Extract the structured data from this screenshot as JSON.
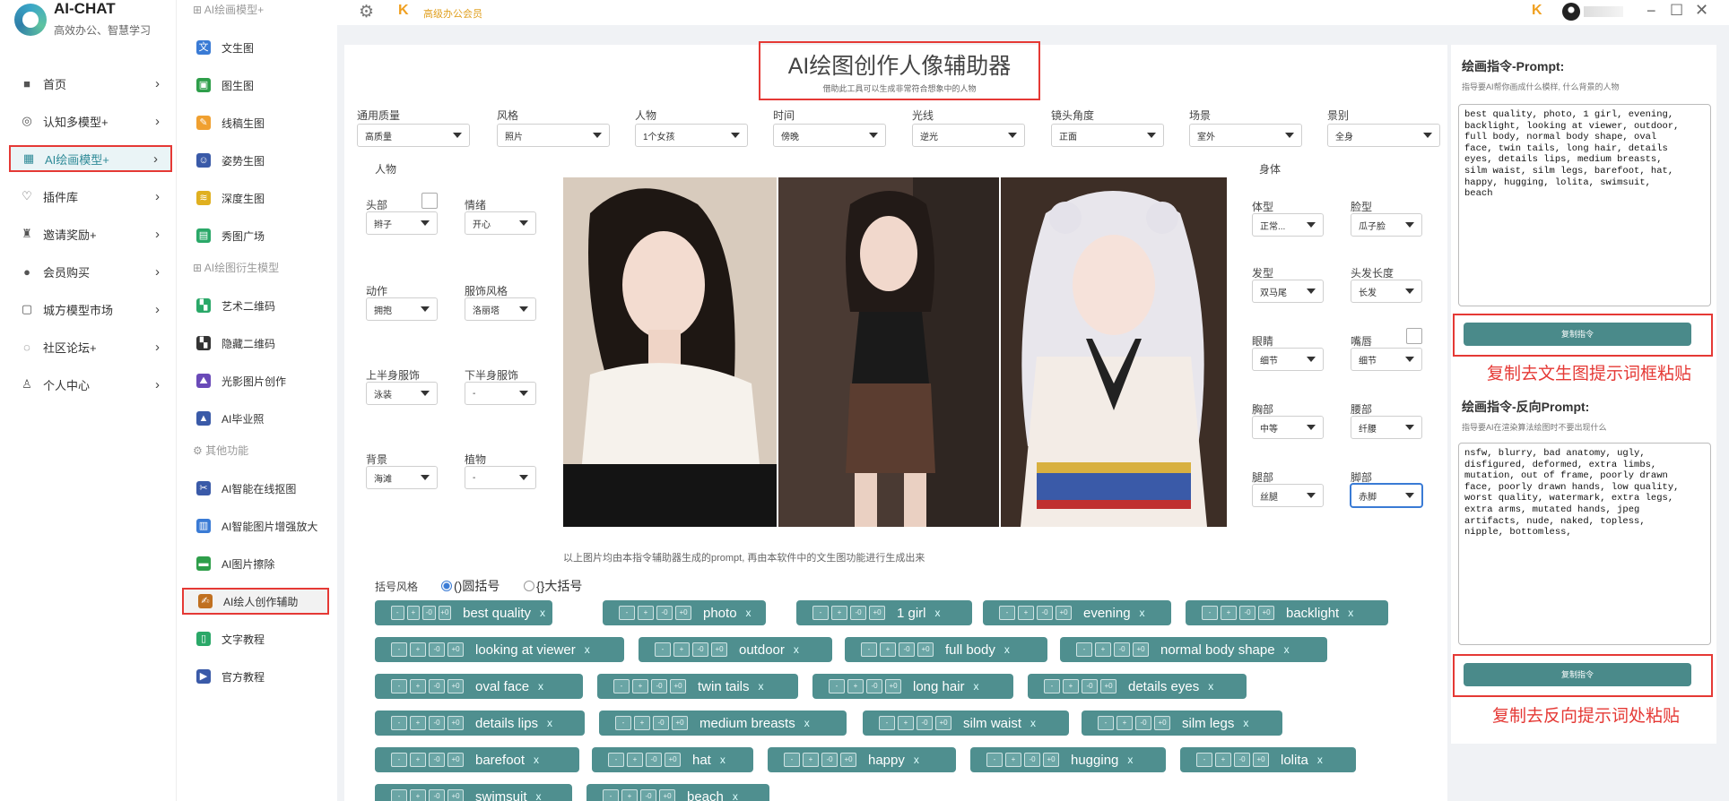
{
  "app": {
    "name": "AI-CHAT",
    "tagline": "高效办公、智慧学习"
  },
  "sidebar": {
    "items": [
      {
        "label": "首页",
        "icon": "home-icon"
      },
      {
        "label": "认知多模型+",
        "icon": "brain-icon"
      },
      {
        "label": "AI绘画模型+",
        "icon": "paint-icon"
      },
      {
        "label": "插件库",
        "icon": "plugin-icon"
      },
      {
        "label": "邀请奖励+",
        "icon": "gift-icon"
      },
      {
        "label": "会员购买",
        "icon": "user-icon"
      },
      {
        "label": "城方模型市场",
        "icon": "store-icon"
      },
      {
        "label": "社区论坛+",
        "icon": "chat-icon"
      },
      {
        "label": "个人中心",
        "icon": "person-icon"
      }
    ]
  },
  "submenu": {
    "header_top": "AI绘画模型+",
    "group1": [
      {
        "label": "文生图",
        "color": "#3a7bd5"
      },
      {
        "label": "图生图",
        "color": "#2e9e4a"
      },
      {
        "label": "线稿生图",
        "color": "#f0a030"
      },
      {
        "label": "姿势生图",
        "color": "#3a5aa8"
      },
      {
        "label": "深度生图",
        "color": "#e0b020"
      },
      {
        "label": "秀图广场",
        "color": "#2aa868"
      }
    ],
    "header_derive": "AI绘图衍生模型",
    "group2": [
      {
        "label": "艺术二维码",
        "color": "#2aa868"
      },
      {
        "label": "隐藏二维码",
        "color": "#333333"
      },
      {
        "label": "光影图片创作",
        "color": "#6a4ab8"
      },
      {
        "label": "AI毕业照",
        "color": "#3a5aa8"
      }
    ],
    "header_other": "其他功能",
    "group3": [
      {
        "label": "AI智能在线抠图",
        "color": "#3a5aa8"
      },
      {
        "label": "AI智能图片增强放大",
        "color": "#3a7bd5"
      },
      {
        "label": "AI图片擦除",
        "color": "#2e9e4a"
      },
      {
        "label": "AI绘人创作辅助",
        "color": "#c07020"
      },
      {
        "label": "文字教程",
        "color": "#2aa868"
      },
      {
        "label": "官方教程",
        "color": "#3a5aa8"
      }
    ]
  },
  "topbar": {
    "member_label": "高级办公会员"
  },
  "main": {
    "title": "AI绘图创作人像辅助器",
    "subtitle": "借助此工具可以生成非常符合想象中的人物",
    "filters": [
      {
        "label": "通用质量",
        "value": "高质量"
      },
      {
        "label": "风格",
        "value": "照片"
      },
      {
        "label": "人物",
        "value": "1个女孩"
      },
      {
        "label": "时间",
        "value": "傍晚"
      },
      {
        "label": "光线",
        "value": "逆光"
      },
      {
        "label": "镜头角度",
        "value": "正面"
      },
      {
        "label": "场景",
        "value": "室外"
      },
      {
        "label": "景别",
        "value": "全身"
      }
    ],
    "group_person": "人物",
    "group_body": "身体",
    "left_fields": [
      {
        "label": "头部",
        "value": "辫子"
      },
      {
        "label": "情绪",
        "value": "开心"
      },
      {
        "label": "动作",
        "value": "拥抱"
      },
      {
        "label": "服饰风格",
        "value": "洛丽塔"
      },
      {
        "label": "上半身服饰",
        "value": "泳装"
      },
      {
        "label": "下半身服饰",
        "value": "-"
      },
      {
        "label": "背景",
        "value": "海滩"
      },
      {
        "label": "植物",
        "value": "-"
      }
    ],
    "right_fields": [
      {
        "label": "体型",
        "value": "正常..."
      },
      {
        "label": "脸型",
        "value": "瓜子脸"
      },
      {
        "label": "发型",
        "value": "双马尾"
      },
      {
        "label": "头发长度",
        "value": "长发"
      },
      {
        "label": "眼睛",
        "value": "细节"
      },
      {
        "label": "嘴唇",
        "value": "细节"
      },
      {
        "label": "胸部",
        "value": "中等"
      },
      {
        "label": "腰部",
        "value": "纤腰"
      },
      {
        "label": "腿部",
        "value": "丝腿"
      },
      {
        "label": "脚部",
        "value": "赤脚"
      }
    ],
    "caption": "以上图片均由本指令辅助器生成的prompt, 再由本软件中的文生图功能进行生成出来",
    "bracket_label": "括号风格",
    "bracket_options": [
      "()圆括号",
      "{}大括号"
    ],
    "tag_buttons": [
      "-",
      "+",
      "-0",
      "+0"
    ],
    "tags": [
      "best quality",
      "photo",
      "1 girl",
      "evening",
      "backlight",
      "looking at viewer",
      "outdoor",
      "full body",
      "normal body shape",
      "oval face",
      "twin tails",
      "long hair",
      "details eyes",
      "details lips",
      "medium breasts",
      "silm waist",
      "silm legs",
      "barefoot",
      "hat",
      "happy",
      "hugging",
      "lolita",
      "swimsuit",
      "beach"
    ]
  },
  "right_panel": {
    "prompt_title": "绘画指令-Prompt:",
    "prompt_sub": "指导要AI帮你画成什么模样, 什么背景的人物",
    "prompt_text": "best quality, photo, 1 girl, evening,\nbacklight, looking at viewer, outdoor,\nfull body, normal body shape, oval\nface, twin tails, long hair, details\neyes, details lips, medium breasts,\nsilm waist, silm legs, barefoot, hat,\nhappy, hugging, lolita, swimsuit,\nbeach",
    "copy_label": "复制指令",
    "note1": "复制去文生图提示词框粘贴",
    "neg_title": "绘画指令-反向Prompt:",
    "neg_sub": "指导要AI在渲染算法绘图时不要出现什么",
    "neg_text": "nsfw, blurry, bad anatomy, ugly,\ndisfigured, deformed, extra limbs,\nmutation, out of frame, poorly drawn\nface, poorly drawn hands, low quality,\nworst quality, watermark, extra legs,\nextra arms, mutated hands, jpeg\nartifacts, nude, naked, topless,\nnipple, bottomless,",
    "copy_label2": "复制指令",
    "note2": "复制去反向提示词处粘贴"
  },
  "colors": {
    "accent": "#4f8f8f",
    "highlight": "#e53935",
    "brand": "#2e8a97"
  }
}
